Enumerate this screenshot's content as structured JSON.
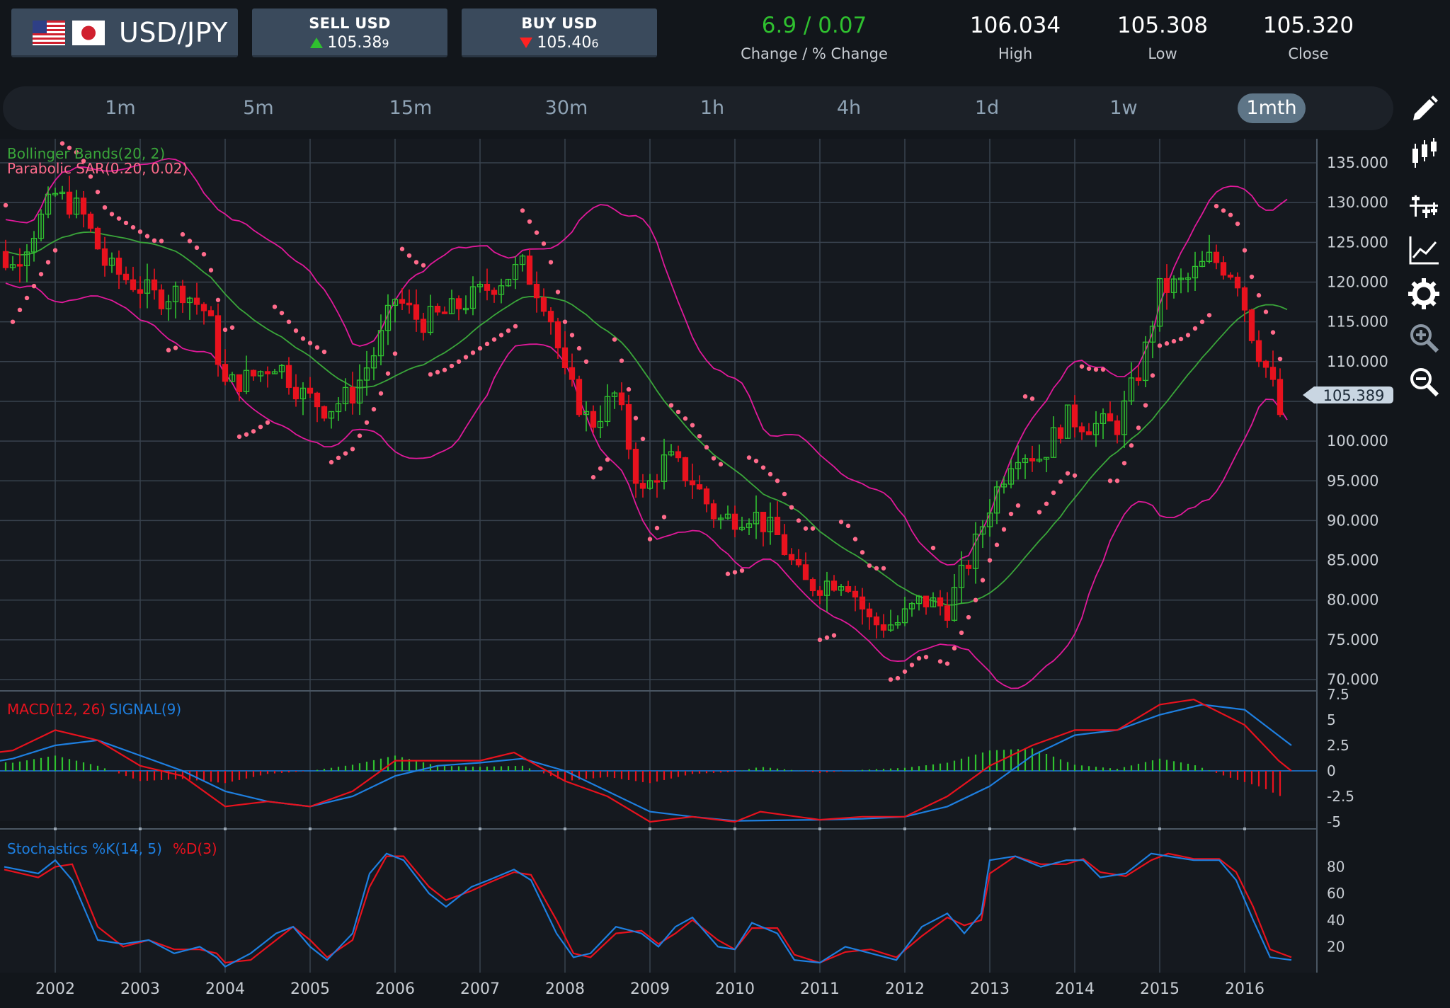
{
  "header": {
    "pair": "USD/JPY",
    "sell": {
      "label": "SELL USD",
      "price": "105.38",
      "pip": "9"
    },
    "buy": {
      "label": "BUY USD",
      "price": "105.40",
      "pip": "6"
    },
    "change": {
      "value": "6.9 / 0.07",
      "label": "Change / % Change"
    },
    "high": {
      "value": "106.034",
      "label": "High"
    },
    "low": {
      "value": "105.308",
      "label": "Low"
    },
    "close": {
      "value": "105.320",
      "label": "Close"
    }
  },
  "timeframes": [
    "1m",
    "5m",
    "15m",
    "30m",
    "1h",
    "4h",
    "1d",
    "1w",
    "1mth"
  ],
  "active_timeframe": "1mth",
  "toolbar": {
    "icons": [
      "pencil-icon",
      "candlestick-icon",
      "crosshair-add-icon",
      "line-chart-icon",
      "gear-icon",
      "zoom-in-icon",
      "zoom-out-icon"
    ]
  },
  "colors": {
    "up": "#2fc02f",
    "down": "#e8121e",
    "bollinger": "#e0199a",
    "bb_mid": "#3aa63a",
    "sar": "#ff6b8b",
    "macd": "#e8121e",
    "signal": "#1e7fe0",
    "accent": "#5e7587"
  },
  "chart_data": {
    "type": "candlestick",
    "x": [
      "2002",
      "2003",
      "2004",
      "2005",
      "2006",
      "2007",
      "2008",
      "2009",
      "2010",
      "2011",
      "2012",
      "2013",
      "2014",
      "2015",
      "2016"
    ],
    "price_ticks": [
      "135.000",
      "130.000",
      "125.000",
      "120.000",
      "115.000",
      "110.000",
      "100.000",
      "95.000",
      "90.000",
      "85.000",
      "80.000",
      "75.000",
      "70.000"
    ],
    "ylim": [
      68,
      137
    ],
    "current_price": "105.389",
    "indicators": {
      "bollinger_label": "Bollinger Bands(20, 2)",
      "sar_label": "Parabolic SAR(0.20, 0.02)"
    },
    "close_series": [
      [
        2001.0,
        126
      ],
      [
        2001.5,
        122
      ],
      [
        2002.0,
        131
      ],
      [
        2002.3,
        129
      ],
      [
        2002.6,
        122
      ],
      [
        2002.9,
        120
      ],
      [
        2003.2,
        118
      ],
      [
        2003.5,
        119
      ],
      [
        2003.8,
        116
      ],
      [
        2004.0,
        107
      ],
      [
        2004.3,
        108
      ],
      [
        2004.6,
        110
      ],
      [
        2004.9,
        106
      ],
      [
        2005.2,
        104
      ],
      [
        2005.5,
        106
      ],
      [
        2005.8,
        112
      ],
      [
        2006.0,
        118
      ],
      [
        2006.3,
        115
      ],
      [
        2006.6,
        116
      ],
      [
        2006.9,
        118
      ],
      [
        2007.2,
        120
      ],
      [
        2007.5,
        122
      ],
      [
        2007.8,
        117
      ],
      [
        2008.0,
        108
      ],
      [
        2008.3,
        102
      ],
      [
        2008.6,
        106
      ],
      [
        2008.9,
        93
      ],
      [
        2009.2,
        98
      ],
      [
        2009.5,
        95
      ],
      [
        2009.8,
        90
      ],
      [
        2010.2,
        91
      ],
      [
        2010.5,
        88
      ],
      [
        2010.8,
        82
      ],
      [
        2011.0,
        82
      ],
      [
        2011.3,
        83
      ],
      [
        2011.6,
        77
      ],
      [
        2011.9,
        77
      ],
      [
        2012.2,
        80
      ],
      [
        2012.5,
        79
      ],
      [
        2012.8,
        86
      ],
      [
        2013.0,
        92
      ],
      [
        2013.3,
        99
      ],
      [
        2013.6,
        98
      ],
      [
        2013.9,
        103
      ],
      [
        2014.2,
        102
      ],
      [
        2014.5,
        102
      ],
      [
        2014.8,
        110
      ],
      [
        2015.0,
        119
      ],
      [
        2015.3,
        120
      ],
      [
        2015.6,
        123
      ],
      [
        2015.9,
        121
      ],
      [
        2016.1,
        113
      ],
      [
        2016.3,
        108
      ],
      [
        2016.45,
        102
      ],
      [
        2016.55,
        105
      ]
    ],
    "macd_panel": {
      "label_macd": "MACD(12, 26)",
      "label_signal": "SIGNAL(9)",
      "ticks": [
        "7.5",
        "5",
        "2.5",
        "0",
        "-2.5",
        "-5"
      ],
      "ylim": [
        -5,
        7.5
      ],
      "macd": [
        [
          2001.0,
          1.5
        ],
        [
          2001.5,
          2.0
        ],
        [
          2002.0,
          4.0
        ],
        [
          2002.5,
          3.0
        ],
        [
          2003.0,
          0.5
        ],
        [
          2003.5,
          -0.5
        ],
        [
          2004.0,
          -3.5
        ],
        [
          2004.5,
          -3.0
        ],
        [
          2005.0,
          -3.5
        ],
        [
          2005.5,
          -2.0
        ],
        [
          2006.0,
          1.0
        ],
        [
          2006.5,
          1.0
        ],
        [
          2007.0,
          1.0
        ],
        [
          2007.4,
          1.8
        ],
        [
          2008.0,
          -1.0
        ],
        [
          2008.5,
          -2.5
        ],
        [
          2009.0,
          -5.0
        ],
        [
          2009.5,
          -4.5
        ],
        [
          2010.0,
          -5.0
        ],
        [
          2010.3,
          -4.0
        ],
        [
          2011.0,
          -4.8
        ],
        [
          2011.5,
          -4.5
        ],
        [
          2012.0,
          -4.5
        ],
        [
          2012.5,
          -2.5
        ],
        [
          2013.0,
          0.5
        ],
        [
          2013.5,
          2.5
        ],
        [
          2014.0,
          4.0
        ],
        [
          2014.5,
          4.0
        ],
        [
          2015.0,
          6.5
        ],
        [
          2015.4,
          7.0
        ],
        [
          2016.0,
          4.5
        ],
        [
          2016.4,
          1.0
        ],
        [
          2016.55,
          0.0
        ]
      ],
      "signal": [
        [
          2001.0,
          0.5
        ],
        [
          2001.5,
          1.2
        ],
        [
          2002.0,
          2.5
        ],
        [
          2002.5,
          3.0
        ],
        [
          2003.0,
          1.5
        ],
        [
          2003.5,
          0.0
        ],
        [
          2004.0,
          -2.0
        ],
        [
          2004.5,
          -3.0
        ],
        [
          2005.0,
          -3.5
        ],
        [
          2005.5,
          -2.5
        ],
        [
          2006.0,
          -0.5
        ],
        [
          2006.5,
          0.5
        ],
        [
          2007.0,
          0.8
        ],
        [
          2007.5,
          1.2
        ],
        [
          2008.0,
          0.0
        ],
        [
          2008.5,
          -2.0
        ],
        [
          2009.0,
          -4.0
        ],
        [
          2009.5,
          -4.5
        ],
        [
          2010.0,
          -4.9
        ],
        [
          2011.0,
          -4.8
        ],
        [
          2011.5,
          -4.7
        ],
        [
          2012.0,
          -4.5
        ],
        [
          2012.5,
          -3.5
        ],
        [
          2013.0,
          -1.5
        ],
        [
          2013.5,
          1.5
        ],
        [
          2014.0,
          3.5
        ],
        [
          2014.5,
          4.0
        ],
        [
          2015.0,
          5.5
        ],
        [
          2015.5,
          6.5
        ],
        [
          2016.0,
          6.0
        ],
        [
          2016.55,
          2.5
        ]
      ],
      "histogram": [
        [
          2001.0,
          1.0
        ],
        [
          2001.5,
          0.8
        ],
        [
          2002.0,
          1.5
        ],
        [
          2002.5,
          0.5
        ],
        [
          2003.0,
          -1.0
        ],
        [
          2003.5,
          -0.8
        ],
        [
          2004.0,
          -1.2
        ],
        [
          2004.5,
          -0.3
        ],
        [
          2005.0,
          0.0
        ],
        [
          2005.5,
          0.6
        ],
        [
          2006.0,
          1.5
        ],
        [
          2006.5,
          0.5
        ],
        [
          2007.0,
          0.4
        ],
        [
          2007.5,
          0.5
        ],
        [
          2008.0,
          -1.0
        ],
        [
          2008.5,
          -0.6
        ],
        [
          2009.0,
          -1.2
        ],
        [
          2009.5,
          -0.3
        ],
        [
          2010.0,
          -0.1
        ],
        [
          2010.3,
          0.4
        ],
        [
          2011.0,
          -0.2
        ],
        [
          2011.5,
          0.1
        ],
        [
          2012.0,
          0.3
        ],
        [
          2012.5,
          0.8
        ],
        [
          2013.0,
          2.0
        ],
        [
          2013.5,
          2.2
        ],
        [
          2014.0,
          0.6
        ],
        [
          2014.5,
          0.2
        ],
        [
          2015.0,
          1.2
        ],
        [
          2015.4,
          0.6
        ],
        [
          2015.8,
          -0.6
        ],
        [
          2016.2,
          -1.6
        ],
        [
          2016.55,
          -3.0
        ]
      ]
    },
    "stochastics_panel": {
      "label_k": "Stochastics %K(14, 5)",
      "label_d": "%D(3)",
      "ticks": [
        "80",
        "60",
        "40",
        "20"
      ],
      "ylim": [
        0,
        100
      ],
      "k": [
        [
          2001.4,
          80
        ],
        [
          2001.8,
          75
        ],
        [
          2002.0,
          85
        ],
        [
          2002.2,
          70
        ],
        [
          2002.5,
          25
        ],
        [
          2002.8,
          22
        ],
        [
          2003.1,
          25
        ],
        [
          2003.4,
          15
        ],
        [
          2003.7,
          20
        ],
        [
          2003.9,
          12
        ],
        [
          2004.0,
          5
        ],
        [
          2004.3,
          15
        ],
        [
          2004.6,
          30
        ],
        [
          2004.8,
          35
        ],
        [
          2005.0,
          20
        ],
        [
          2005.2,
          10
        ],
        [
          2005.5,
          30
        ],
        [
          2005.7,
          75
        ],
        [
          2005.9,
          90
        ],
        [
          2006.1,
          85
        ],
        [
          2006.4,
          60
        ],
        [
          2006.6,
          50
        ],
        [
          2006.9,
          65
        ],
        [
          2007.1,
          70
        ],
        [
          2007.4,
          78
        ],
        [
          2007.6,
          70
        ],
        [
          2007.9,
          30
        ],
        [
          2008.1,
          12
        ],
        [
          2008.3,
          15
        ],
        [
          2008.6,
          35
        ],
        [
          2008.9,
          30
        ],
        [
          2009.1,
          20
        ],
        [
          2009.3,
          35
        ],
        [
          2009.5,
          42
        ],
        [
          2009.8,
          20
        ],
        [
          2010.0,
          18
        ],
        [
          2010.2,
          38
        ],
        [
          2010.5,
          30
        ],
        [
          2010.7,
          10
        ],
        [
          2011.0,
          8
        ],
        [
          2011.3,
          20
        ],
        [
          2011.6,
          15
        ],
        [
          2011.9,
          10
        ],
        [
          2012.2,
          35
        ],
        [
          2012.5,
          45
        ],
        [
          2012.7,
          30
        ],
        [
          2012.9,
          45
        ],
        [
          2013.0,
          85
        ],
        [
          2013.3,
          88
        ],
        [
          2013.6,
          80
        ],
        [
          2013.9,
          85
        ],
        [
          2014.1,
          85
        ],
        [
          2014.3,
          72
        ],
        [
          2014.6,
          75
        ],
        [
          2014.9,
          90
        ],
        [
          2015.1,
          88
        ],
        [
          2015.4,
          85
        ],
        [
          2015.7,
          85
        ],
        [
          2015.9,
          70
        ],
        [
          2016.1,
          40
        ],
        [
          2016.3,
          12
        ],
        [
          2016.55,
          10
        ]
      ],
      "d": [
        [
          2001.4,
          78
        ],
        [
          2001.8,
          72
        ],
        [
          2002.0,
          80
        ],
        [
          2002.2,
          82
        ],
        [
          2002.5,
          35
        ],
        [
          2002.8,
          20
        ],
        [
          2003.1,
          25
        ],
        [
          2003.4,
          18
        ],
        [
          2003.7,
          18
        ],
        [
          2003.9,
          15
        ],
        [
          2004.0,
          8
        ],
        [
          2004.3,
          10
        ],
        [
          2004.6,
          25
        ],
        [
          2004.8,
          35
        ],
        [
          2005.0,
          25
        ],
        [
          2005.2,
          12
        ],
        [
          2005.5,
          25
        ],
        [
          2005.7,
          65
        ],
        [
          2005.9,
          88
        ],
        [
          2006.1,
          88
        ],
        [
          2006.4,
          65
        ],
        [
          2006.6,
          55
        ],
        [
          2006.9,
          62
        ],
        [
          2007.1,
          68
        ],
        [
          2007.4,
          76
        ],
        [
          2007.6,
          74
        ],
        [
          2007.9,
          40
        ],
        [
          2008.1,
          15
        ],
        [
          2008.3,
          12
        ],
        [
          2008.6,
          30
        ],
        [
          2008.9,
          32
        ],
        [
          2009.1,
          22
        ],
        [
          2009.3,
          30
        ],
        [
          2009.5,
          40
        ],
        [
          2009.8,
          25
        ],
        [
          2010.0,
          18
        ],
        [
          2010.2,
          34
        ],
        [
          2010.5,
          34
        ],
        [
          2010.7,
          14
        ],
        [
          2011.0,
          8
        ],
        [
          2011.3,
          16
        ],
        [
          2011.6,
          18
        ],
        [
          2011.9,
          12
        ],
        [
          2012.2,
          28
        ],
        [
          2012.5,
          42
        ],
        [
          2012.7,
          36
        ],
        [
          2012.9,
          40
        ],
        [
          2013.0,
          75
        ],
        [
          2013.3,
          88
        ],
        [
          2013.6,
          82
        ],
        [
          2013.9,
          82
        ],
        [
          2014.1,
          86
        ],
        [
          2014.3,
          76
        ],
        [
          2014.6,
          73
        ],
        [
          2014.9,
          85
        ],
        [
          2015.1,
          90
        ],
        [
          2015.4,
          86
        ],
        [
          2015.7,
          86
        ],
        [
          2015.9,
          76
        ],
        [
          2016.1,
          50
        ],
        [
          2016.3,
          18
        ],
        [
          2016.55,
          12
        ]
      ]
    }
  }
}
